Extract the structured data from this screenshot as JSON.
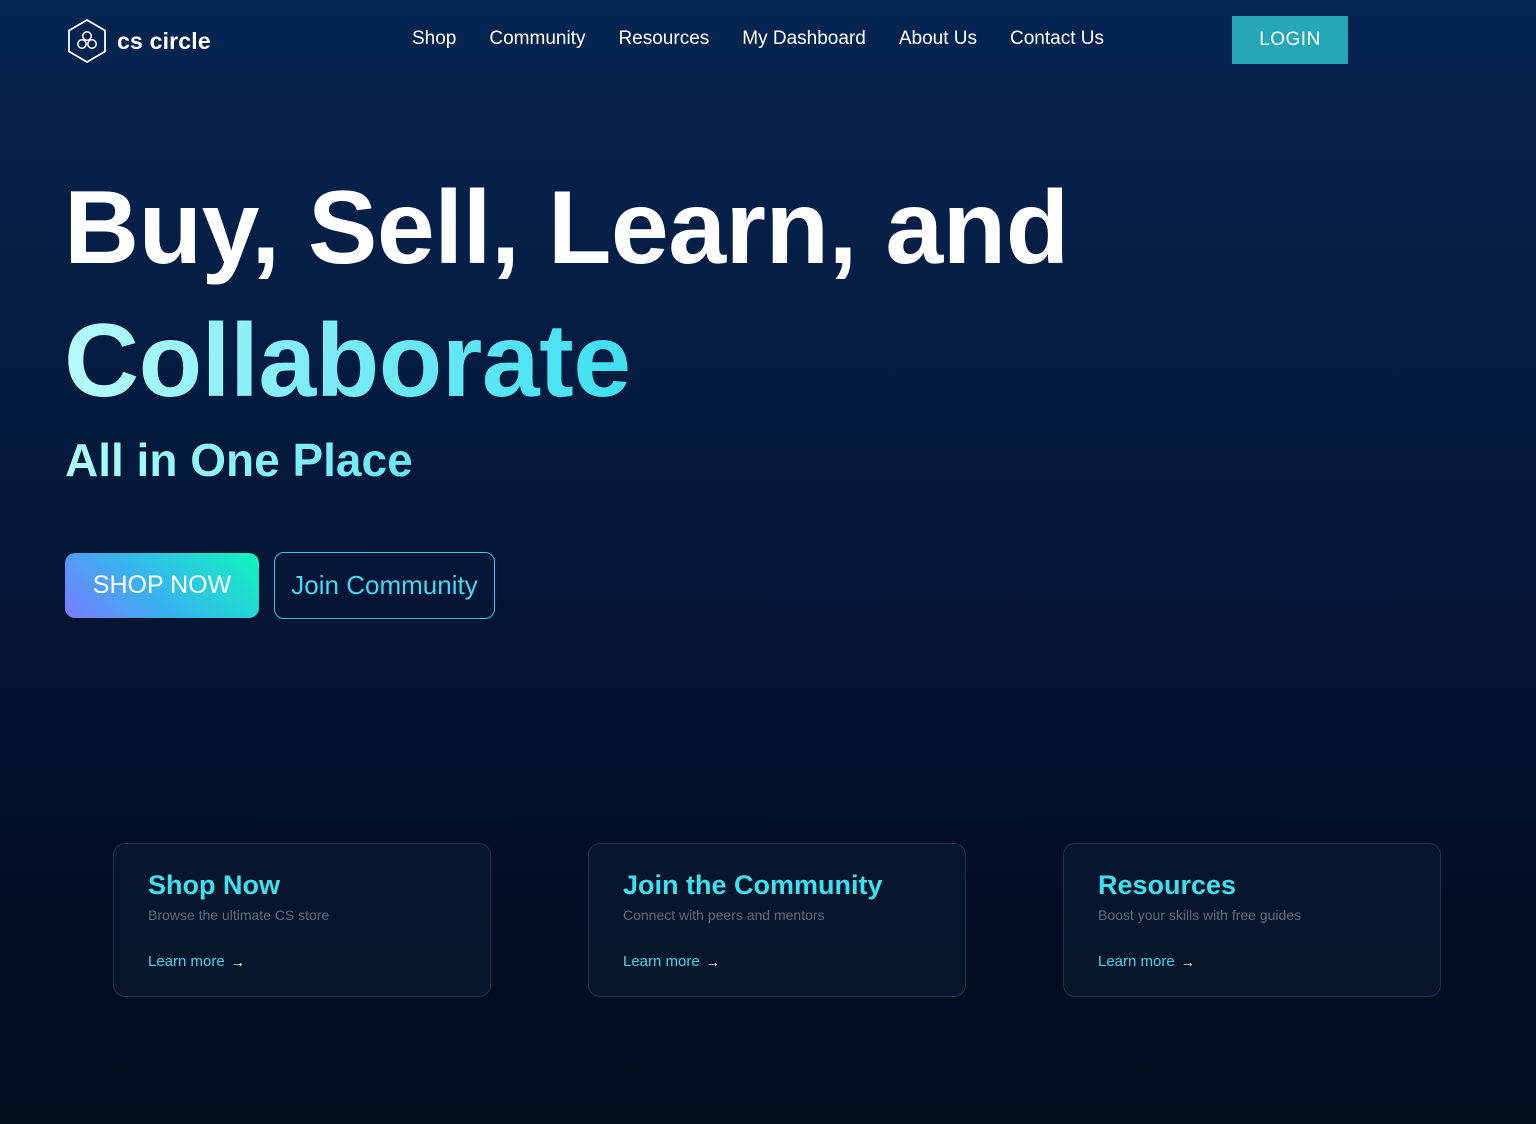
{
  "brand": {
    "name": "cs circle",
    "logo_icon": "hexagon-circles-logo-icon"
  },
  "nav": {
    "items": [
      {
        "label": "Shop"
      },
      {
        "label": "Community"
      },
      {
        "label": "Resources"
      },
      {
        "label": "My Dashboard"
      },
      {
        "label": "About Us"
      },
      {
        "label": "Contact Us"
      }
    ],
    "login_label": "LOGIN"
  },
  "hero": {
    "line1": "Buy, Sell, Learn, and",
    "line2": "Collaborate",
    "subtitle": "All in One Place",
    "primary_cta": "SHOP NOW",
    "secondary_cta": "Join Community"
  },
  "cards": [
    {
      "title": "Shop Now",
      "description": "Browse the ultimate CS store",
      "link": "Learn more",
      "link_icon": "arrow-right-icon"
    },
    {
      "title": "Join the Community",
      "description": "Connect with peers and mentors",
      "link": "Learn more",
      "link_icon": "arrow-right-icon"
    },
    {
      "title": "Resources",
      "description": "Boost your skills with free guides",
      "link": "Learn more",
      "link_icon": "arrow-right-icon"
    }
  ],
  "colors": {
    "background_top": "#062552",
    "background_bottom": "#020c1f",
    "accent_cyan": "#3fe0ef",
    "login_button": "#26a7b8",
    "card_border": "#253246"
  }
}
